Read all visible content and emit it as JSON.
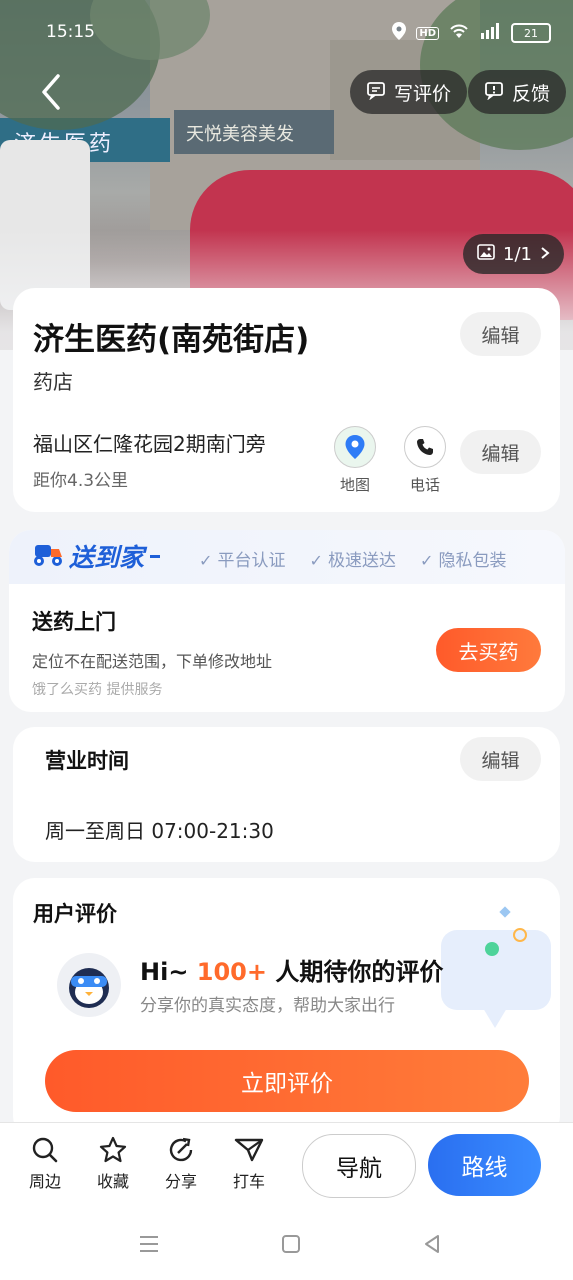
{
  "status_bar": {
    "time": "15:15",
    "battery": "21"
  },
  "header": {
    "write_review_label": "写评价",
    "feedback_label": "反馈",
    "photo_count": "1/1"
  },
  "hero_signs": {
    "left": "济生医药",
    "right": "天悦美容美发"
  },
  "store": {
    "name": "济生医药(南苑街店)",
    "category": "药店",
    "address": "福山区仁隆花园2期南门旁",
    "distance": "距你4.3公里",
    "edit_label": "编辑",
    "map_label": "地图",
    "phone_label": "电话"
  },
  "delivery": {
    "brand": "送到家",
    "badges": [
      "平台认证",
      "极速送达",
      "隐私包装"
    ],
    "title": "送药上门",
    "subtitle": "定位不在配送范围，下单修改地址",
    "provider": "饿了么买药 提供服务",
    "buy_label": "去买药"
  },
  "hours": {
    "title": "营业时间",
    "value": "周一至周日 07:00-21:30",
    "edit_label": "编辑"
  },
  "reviews": {
    "title": "用户评价",
    "prompt_prefix": "Hi~",
    "prompt_count": "100+",
    "prompt_suffix": "人期待你的评价",
    "prompt_sub": "分享你的真实态度，帮助大家出行",
    "cta_label": "立即评价"
  },
  "bottom_nav": {
    "items": [
      {
        "label": "周边",
        "icon": "search-icon"
      },
      {
        "label": "收藏",
        "icon": "star-icon"
      },
      {
        "label": "分享",
        "icon": "share-icon"
      },
      {
        "label": "打车",
        "icon": "taxi-icon"
      }
    ],
    "navigate_label": "导航",
    "route_label": "路线"
  },
  "colors": {
    "accent_orange": "#ff6a2b",
    "accent_blue": "#2f7cf6",
    "brand_blue": "#1e5fd8"
  }
}
